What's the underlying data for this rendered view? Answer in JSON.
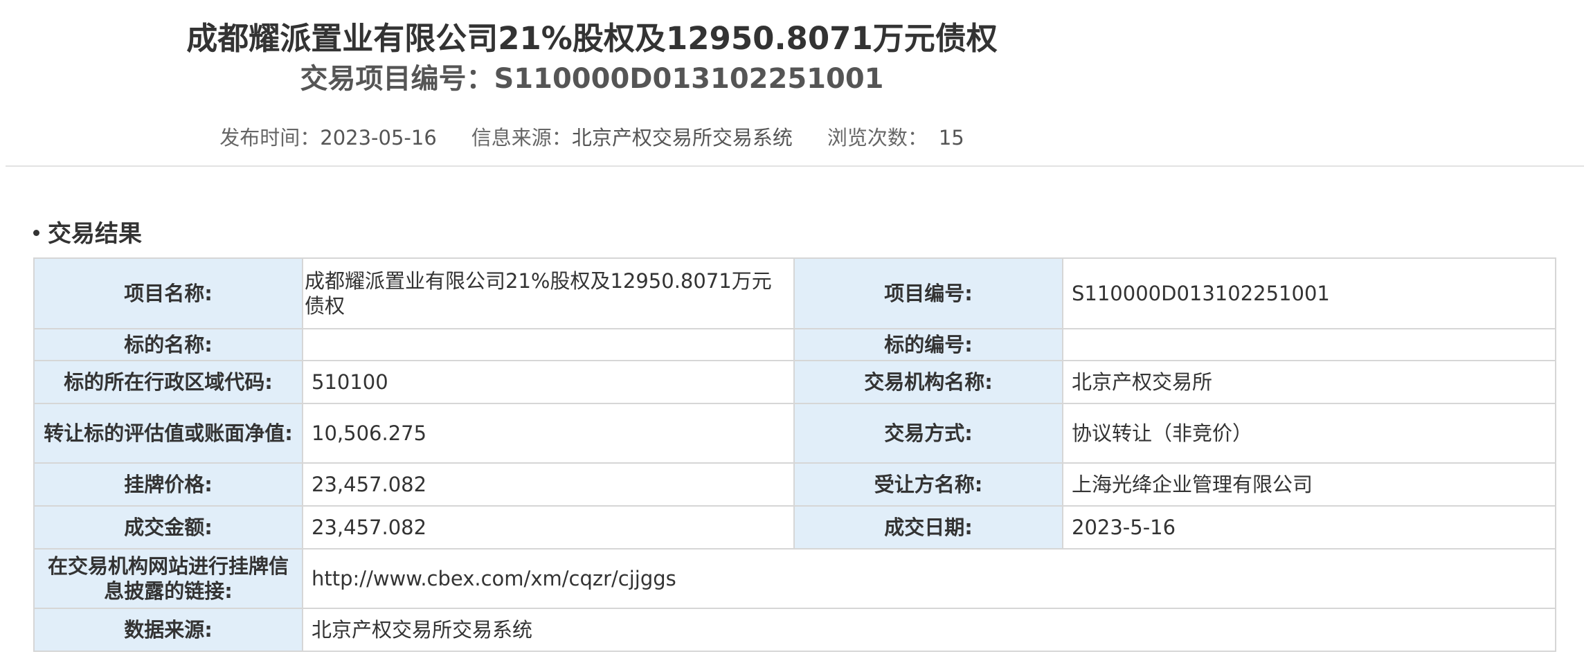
{
  "header": {
    "title": "成都耀派置业有限公司21%股权及12950.8071万元债权",
    "project_code_line": "交易项目编号：S110000D013102251001"
  },
  "meta": {
    "publish_label": "发布时间：",
    "publish_date": "2023-05-16",
    "source_label": "信息来源：",
    "source_value": "北京产权交易所交易系统",
    "views_label": "浏览次数：",
    "views_count": "15"
  },
  "section": {
    "title": "交易结果"
  },
  "table": {
    "rows": [
      {
        "l1": "项目名称:",
        "v1": "成都耀派置业有限公司21%股权及12950.8071万元债权",
        "l2": "项目编号:",
        "v2": "S110000D013102251001"
      },
      {
        "l1": "标的名称:",
        "v1": "",
        "l2": "标的编号:",
        "v2": ""
      },
      {
        "l1": "标的所在行政区域代码:",
        "v1": "510100",
        "l2": "交易机构名称:",
        "v2": "北京产权交易所"
      },
      {
        "l1": "转让标的评估值或账面净值:",
        "v1": "10,506.275",
        "l2": "交易方式:",
        "v2": "协议转让（非竞价）"
      },
      {
        "l1": "挂牌价格:",
        "v1": "23,457.082",
        "l2": "受让方名称:",
        "v2": "上海光绛企业管理有限公司"
      },
      {
        "l1": "成交金额:",
        "v1": "23,457.082",
        "l2": "成交日期:",
        "v2": "2023-5-16"
      }
    ],
    "link_label": "在交易机构网站进行挂牌信息披露的链接:",
    "link_value": "http://www.cbex.com/xm/cqzr/cjjggs",
    "data_source_label": "数据来源:",
    "data_source_value": "北京产权交易所交易系统"
  },
  "colors": {
    "label_bg": "#e1eef9",
    "border": "#d6d6d6",
    "text": "#333333"
  }
}
